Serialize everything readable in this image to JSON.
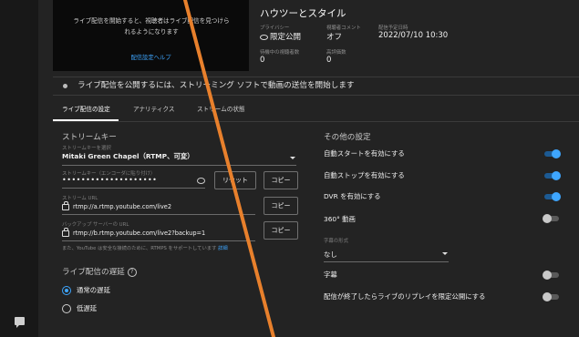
{
  "preview": {
    "message_line1": "ライブ配信を開始すると、視聴者はライブ配信を見つけら",
    "message_line2": "れるようになります",
    "help_link": "配信設定ヘルプ"
  },
  "stream": {
    "title": "ハウツーとスタイル",
    "privacy_label": "プライバシー",
    "privacy_value": "限定公開",
    "comments_label": "視聴者コメント",
    "comments_value": "オフ",
    "scheduled_label": "配信予定日時",
    "scheduled_value": "2022/07/10 10:30",
    "waiting_label": "待機中の視聴者数",
    "waiting_value": "0",
    "likes_label": "高評価数",
    "likes_value": "0"
  },
  "status": {
    "text": "ライブ配信を公開するには、ストリーミング ソフトで動画の送信を開始します"
  },
  "tabs": [
    {
      "label": "ライブ配信の設定"
    },
    {
      "label": "アナリティクス"
    },
    {
      "label": "ストリームの状態"
    }
  ],
  "stream_key": {
    "section_title": "ストリームキー",
    "select_label": "ストリームキーを選択",
    "select_value": "Mitaki Green Chapel（RTMP、可変）",
    "key_label": "ストリームキー（エンコーダに貼り付け）",
    "key_value": "••••••••••••••••••••",
    "reset_button": "リセット",
    "copy_button": "コピー",
    "url_label": "ストリーム URL",
    "url_value": "rtmp://a.rtmp.youtube.com/live2",
    "backup_label": "バックアップ サーバーの URL",
    "backup_value": "rtmp://b.rtmp.youtube.com/live2?backup=1",
    "note": "また、YouTube は安全な接続のために、RTMPS をサポートしています",
    "note_link": "詳細"
  },
  "latency": {
    "title": "ライブ配信の遅延",
    "help_icon": "?",
    "options": [
      {
        "label": "通常の遅延",
        "selected": true
      },
      {
        "label": "低遅延",
        "selected": false
      }
    ]
  },
  "other_settings": {
    "title": "その他の設定",
    "auto_start": {
      "label": "自動スタートを有効にする",
      "on": true
    },
    "auto_stop": {
      "label": "自動ストップを有効にする",
      "on": true
    },
    "dvr": {
      "label": "DVR を有効にする",
      "on": true
    },
    "video_360": {
      "label": "360° 動画",
      "on": false
    },
    "caption_label": "字幕の形式",
    "caption_value": "なし",
    "subtitles": {
      "label": "字幕",
      "on": false
    },
    "replay_unlisted": {
      "label": "配信が終了したらライブのリプレイを限定公開にする",
      "on": false
    }
  },
  "colors": {
    "accent": "#3ea6ff",
    "background": "#232323",
    "overlay_stroke": "#e8802c"
  },
  "icons": {
    "feedback": "feedback-icon",
    "unlisted_eye": "eye-icon",
    "key_visibility": "eye-off-icon",
    "url_lock": "lock-icon",
    "dropdown": "chevron-down-icon"
  }
}
